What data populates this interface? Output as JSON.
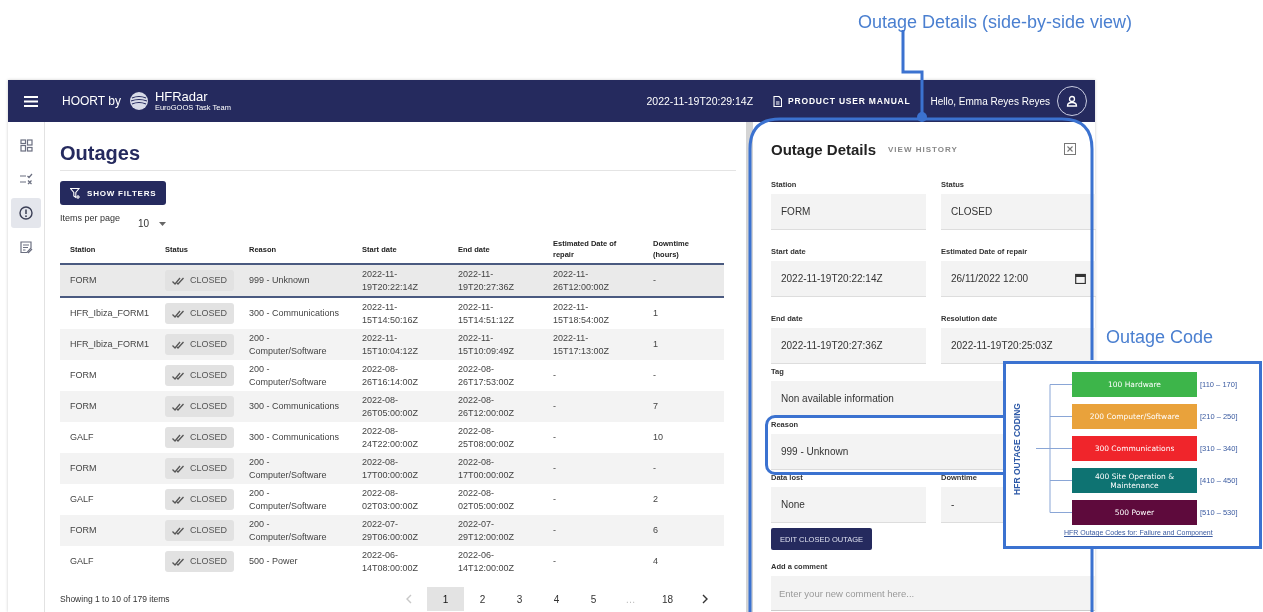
{
  "annotations": {
    "panel_callout": "Outage Details (side-by-side view)",
    "code_callout": "Outage Code"
  },
  "header": {
    "app_name": "HOORT by",
    "logo_text": "HFRadar",
    "logo_subtext": "EuroGOOS Task Team",
    "timestamp": "2022-11-19T20:29:14Z",
    "manual_link": "PRODUCT USER MANUAL",
    "greeting": "Hello, Emma Reyes Reyes"
  },
  "sidebar": {
    "items": [
      {
        "kind": "dashboard",
        "selected": false
      },
      {
        "kind": "checklist",
        "selected": false
      },
      {
        "kind": "alert",
        "selected": true
      },
      {
        "kind": "notes",
        "selected": false
      }
    ]
  },
  "page": {
    "title": "Outages",
    "filter_button": "SHOW FILTERS",
    "items_per_page_label": "Items per page",
    "items_per_page": "10"
  },
  "table": {
    "columns": [
      "Station",
      "Status",
      "Reason",
      "Start date",
      "End date",
      "Estimated Date of repair",
      "Downtime (hours)"
    ],
    "rows": [
      {
        "station": "FORM",
        "status": "CLOSED",
        "reason": "999 - Unknown",
        "start": "2022-11-19T20:22:14Z",
        "end": "2022-11-19T20:27:36Z",
        "estimated": "2022-11-26T12:00:00Z",
        "downtime": "-",
        "selected": true
      },
      {
        "station": "HFR_Ibiza_FORM1",
        "status": "CLOSED",
        "reason": "300 - Communications",
        "start": "2022-11-15T14:50:16Z",
        "end": "2022-11-15T14:51:12Z",
        "estimated": "2022-11-15T18:54:00Z",
        "downtime": "1",
        "selected": false
      },
      {
        "station": "HFR_Ibiza_FORM1",
        "status": "CLOSED",
        "reason": "200 - Computer/Software",
        "start": "2022-11-15T10:04:12Z",
        "end": "2022-11-15T10:09:49Z",
        "estimated": "2022-11-15T17:13:00Z",
        "downtime": "1",
        "selected": false
      },
      {
        "station": "FORM",
        "status": "CLOSED",
        "reason": "200 - Computer/Software",
        "start": "2022-08-26T16:14:00Z",
        "end": "2022-08-26T17:53:00Z",
        "estimated": "-",
        "downtime": "-",
        "selected": false
      },
      {
        "station": "FORM",
        "status": "CLOSED",
        "reason": "300 - Communications",
        "start": "2022-08-26T05:00:00Z",
        "end": "2022-08-26T12:00:00Z",
        "estimated": "-",
        "downtime": "7",
        "selected": false
      },
      {
        "station": "GALF",
        "status": "CLOSED",
        "reason": "300 - Communications",
        "start": "2022-08-24T22:00:00Z",
        "end": "2022-08-25T08:00:00Z",
        "estimated": "-",
        "downtime": "10",
        "selected": false
      },
      {
        "station": "FORM",
        "status": "CLOSED",
        "reason": "200 - Computer/Software",
        "start": "2022-08-17T00:00:00Z",
        "end": "2022-08-17T00:00:00Z",
        "estimated": "-",
        "downtime": "-",
        "selected": false
      },
      {
        "station": "GALF",
        "status": "CLOSED",
        "reason": "200 - Computer/Software",
        "start": "2022-08-02T03:00:00Z",
        "end": "2022-08-02T05:00:00Z",
        "estimated": "-",
        "downtime": "2",
        "selected": false
      },
      {
        "station": "FORM",
        "status": "CLOSED",
        "reason": "200 - Computer/Software",
        "start": "2022-07-29T06:00:00Z",
        "end": "2022-07-29T12:00:00Z",
        "estimated": "-",
        "downtime": "6",
        "selected": false
      },
      {
        "station": "GALF",
        "status": "CLOSED",
        "reason": "500 - Power",
        "start": "2022-06-14T08:00:00Z",
        "end": "2022-06-14T12:00:00Z",
        "estimated": "-",
        "downtime": "4",
        "selected": false
      }
    ]
  },
  "pagination": {
    "summary": "Showing 1 to 10 of 179 items",
    "previous_disabled": true,
    "pages": [
      {
        "label": "1",
        "kind": "page",
        "selected": true
      },
      {
        "label": "2",
        "kind": "page",
        "selected": false
      },
      {
        "label": "3",
        "kind": "page",
        "selected": false
      },
      {
        "label": "4",
        "kind": "page",
        "selected": false
      },
      {
        "label": "5",
        "kind": "page",
        "selected": false
      },
      {
        "label": "…",
        "kind": "gap"
      },
      {
        "label": "18",
        "kind": "page",
        "selected": false
      }
    ]
  },
  "panel": {
    "title": "Outage Details",
    "history_link": "VIEW HISTORY",
    "fields": [
      {
        "label": "Station",
        "value": "FORM",
        "kind": "text"
      },
      {
        "label": "Status",
        "value": "CLOSED",
        "kind": "text"
      },
      {
        "label": "Start date",
        "value": "2022-11-19T20:22:14Z",
        "kind": "text"
      },
      {
        "label": "Estimated Date of repair",
        "value": "26/11/2022 12:00",
        "kind": "date"
      },
      {
        "label": "End date",
        "value": "2022-11-19T20:27:36Z",
        "kind": "text"
      },
      {
        "label": "Resolution date",
        "value": "2022-11-19T20:25:03Z",
        "kind": "text"
      },
      {
        "label": "Tag",
        "value": "Non available information",
        "kind": "wide"
      },
      {
        "label": "Reason",
        "value": "999 - Unknown",
        "kind": "wide"
      },
      {
        "label": "Data lost",
        "value": "None",
        "kind": "text"
      },
      {
        "label": "Downtime",
        "value": "-",
        "kind": "text"
      }
    ],
    "edit_button": "EDIT CLOSED OUTAGE",
    "comment": {
      "label": "Add a comment",
      "placeholder": "Enter your new comment here..."
    }
  },
  "outage_code": {
    "vertical_label": "HFR OUTAGE CODING",
    "categories": [
      {
        "label": "100 Hardware",
        "range": "[110 – 170]",
        "color": "#3db54a"
      },
      {
        "label": "200 Computer/Software",
        "range": "[210 – 250]",
        "color": "#e9a23b"
      },
      {
        "label": "300 Communications",
        "range": "[310 – 340]",
        "color": "#f0252b"
      },
      {
        "label": "400 Site Operation & Maintenance",
        "range": "[410 – 450]",
        "color": "#0e7372"
      },
      {
        "label": "500 Power",
        "range": "[510 – 530]",
        "color": "#5e0a3c"
      }
    ],
    "caption": "HFR Outage Codes for: Failure and Component"
  }
}
